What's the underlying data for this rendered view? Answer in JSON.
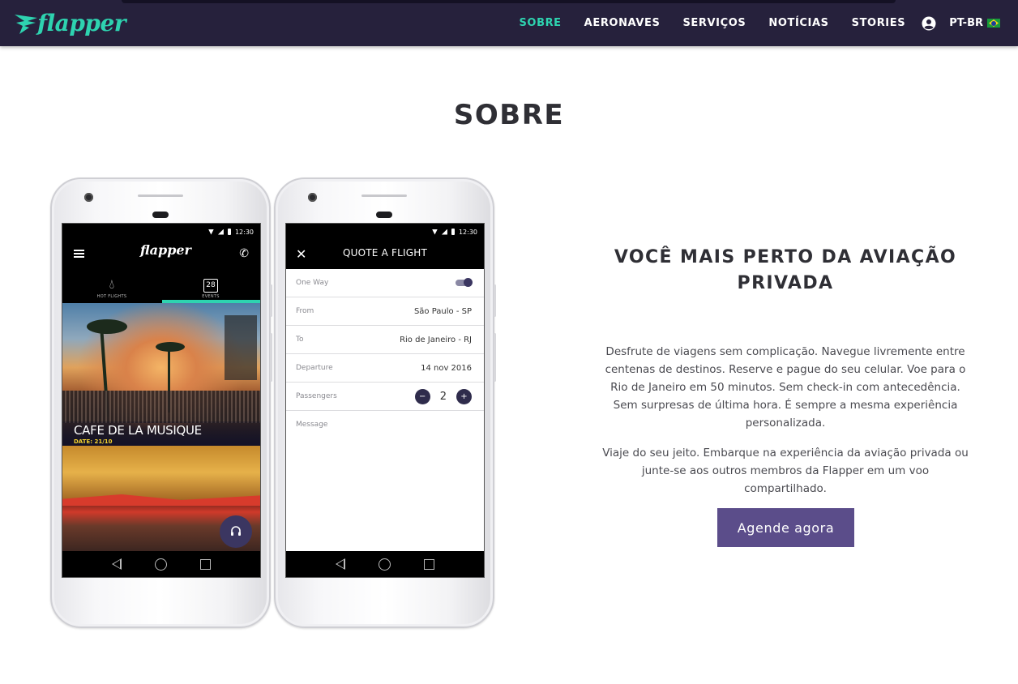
{
  "brand": {
    "name": "flapper",
    "accent": "#2ed3b0",
    "nav_bg": "#26213c",
    "cta_color": "#5b4d8a"
  },
  "nav": {
    "items": [
      {
        "label": "SOBRE",
        "active": true
      },
      {
        "label": "AERONAVES",
        "active": false
      },
      {
        "label": "SERVIÇOS",
        "active": false
      },
      {
        "label": "NOTÍCIAS",
        "active": false
      },
      {
        "label": "STORIES",
        "active": false
      }
    ],
    "user_icon": "account-circle-icon",
    "language": "PT-BR",
    "flag": "brazil-flag-icon"
  },
  "section": {
    "title": "SOBRE"
  },
  "phone1": {
    "status_time": "12:30",
    "app_logo": "flapper",
    "tabs": [
      {
        "label": "HOT FLIGHTS",
        "icon": "drop-icon"
      },
      {
        "label": "EVENTS",
        "icon": "calendar-icon",
        "day": "28",
        "active": true
      }
    ],
    "event": {
      "title": "CAFE DE LA MUSIQUE",
      "date": "DATE:  21/10"
    },
    "fab_icon": "headset-icon"
  },
  "phone2": {
    "status_time": "12:30",
    "header_title": "QUOTE A FLIGHT",
    "fields": {
      "one_way": {
        "label": "One Way",
        "on": true
      },
      "from": {
        "label": "From",
        "value": "São Paulo - SP"
      },
      "to": {
        "label": "To",
        "value": "Rio de Janeiro - RJ"
      },
      "departure": {
        "label": "Departure",
        "value": "14 nov 2016"
      },
      "passengers": {
        "label": "Passengers",
        "value": "2",
        "minus": "−",
        "plus": "+"
      },
      "message": {
        "label": "Message"
      }
    }
  },
  "content": {
    "tagline": "VOCÊ MAIS PERTO DA AVIAÇÃO PRIVADA",
    "paragraph_1": "Desfrute de viagens sem complicação. Navegue livremente entre centenas de destinos. Reserve e pague do seu celular. Voe para o Rio de Janeiro em 50 minutos. Sem check-in com antecedência. Sem surpresas de última hora. É sempre a mesma experiência personalizada.",
    "paragraph_2": "Viaje do seu jeito. Embarque na experiência da aviação privada ou junte-se aos outros membros da Flapper em um voo compartilhado.",
    "cta_label": "Agende agora"
  }
}
